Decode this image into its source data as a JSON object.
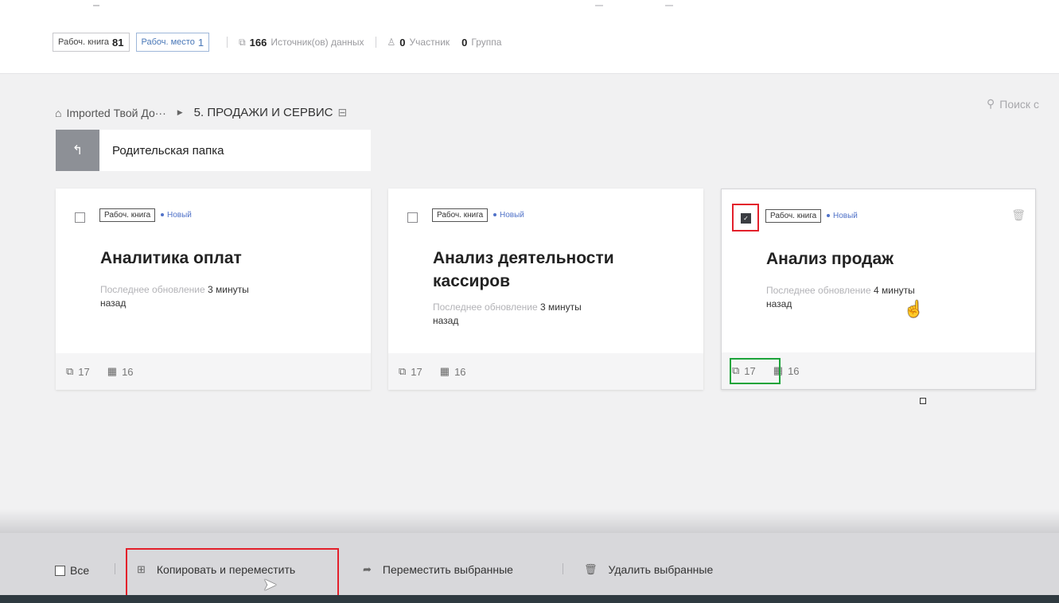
{
  "topbar": {
    "workbook_label": "Рабоч. книга",
    "workbook_count": "81",
    "workspace_label": "Рабоч. место",
    "workspace_count": "1",
    "sources_count": "166",
    "sources_label": "Источник(ов) данных",
    "members_count": "0",
    "members_label": "Участник",
    "groups_count": "0",
    "groups_label": "Группа"
  },
  "breadcrumb": {
    "root": "Imported Твой До···",
    "current": "5. ПРОДАЖИ И СЕРВИС"
  },
  "search": {
    "placeholder": "Поиск с"
  },
  "parent_folder": {
    "label": "Родительская папка"
  },
  "cards": [
    {
      "tag": "Рабоч. книга",
      "status": "Новый",
      "title": "Аналитика оплат",
      "updated_label": "Последнее обновление",
      "updated_value": "3 минуты",
      "updated_ago": "назад",
      "sources": "17",
      "sheets": "16",
      "checked": false
    },
    {
      "tag": "Рабоч. книга",
      "status": "Новый",
      "title": "Анализ деятельности кассиров",
      "updated_label": "Последнее обновление",
      "updated_value": "3 минуты",
      "updated_ago": "назад",
      "sources": "17",
      "sheets": "16",
      "checked": false
    },
    {
      "tag": "Рабоч. книга",
      "status": "Новый",
      "title": "Анализ продаж",
      "updated_label": "Последнее обновление",
      "updated_value": "4 минуты",
      "updated_ago": "назад",
      "sources": "17",
      "sheets": "16",
      "checked": true
    }
  ],
  "bottombar": {
    "all_label": "Все",
    "copy_move": "Копировать и переместить",
    "move_selected": "Переместить выбранные",
    "delete_selected": "Удалить выбранные"
  },
  "colors": {
    "highlight_red": "#e3202b",
    "highlight_green": "#1ca43a",
    "status_blue": "#5072c8"
  }
}
